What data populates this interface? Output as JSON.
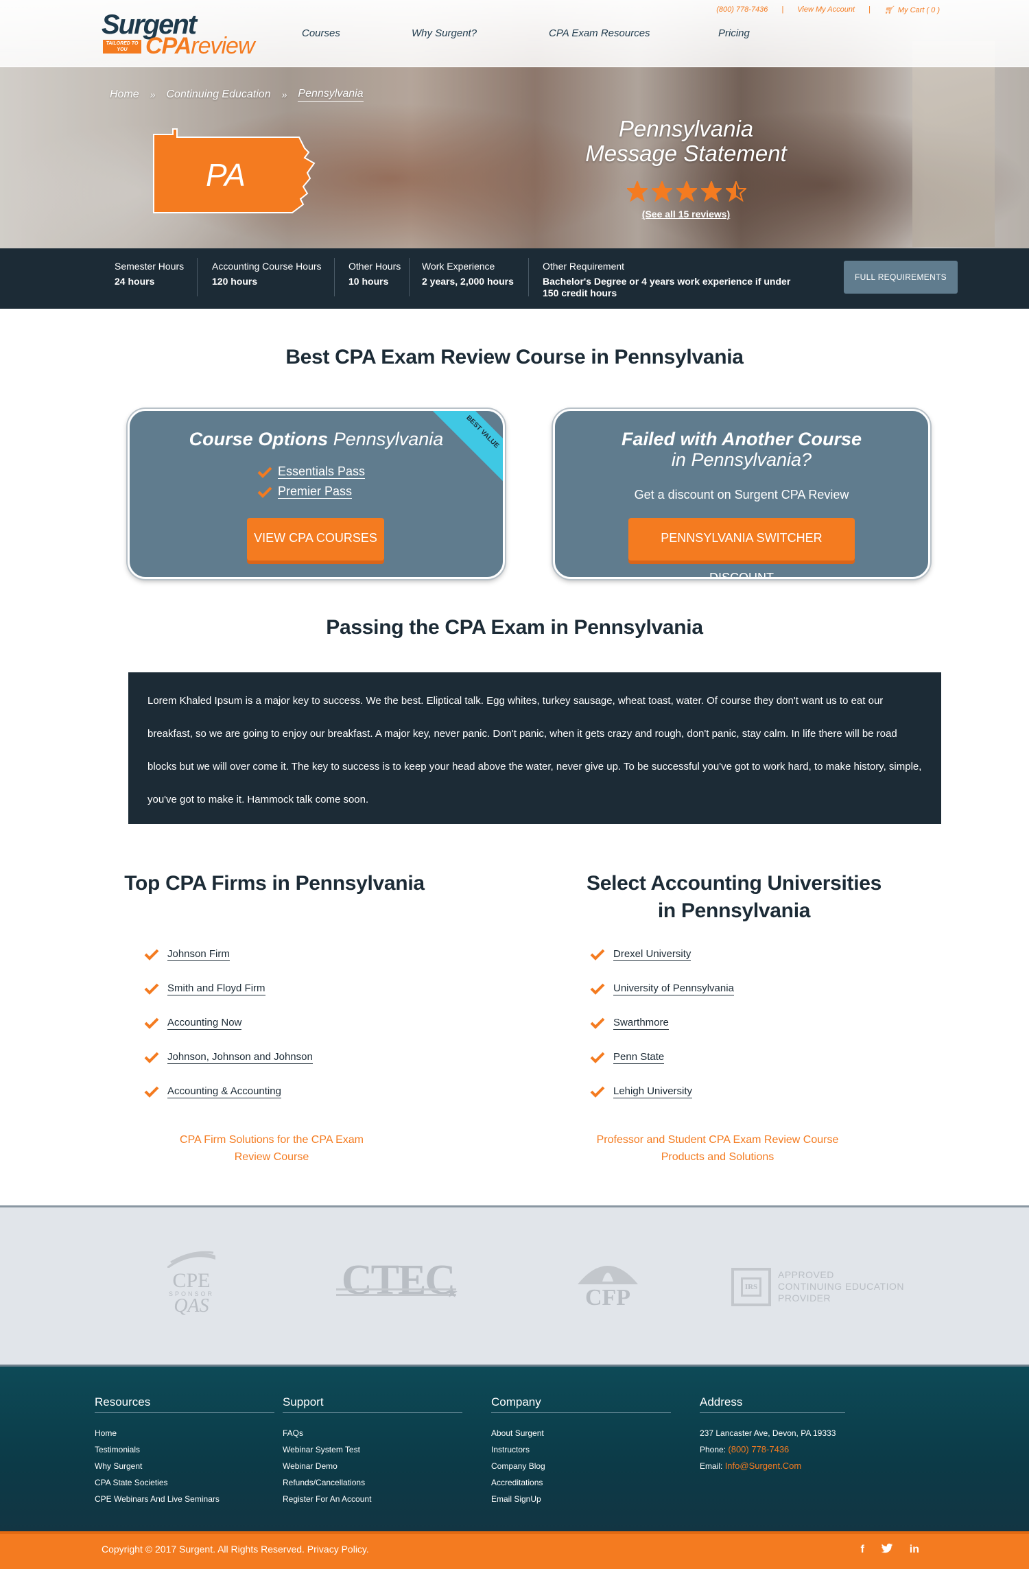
{
  "header": {
    "logo": {
      "brand": "Surgent",
      "product_strong": "CPA",
      "product_light": "review",
      "tagline": "TAILORED TO YOU"
    },
    "utility": {
      "phone": "(800) 778-7436",
      "account": "View My Account",
      "cart": "My Cart  ( 0 )"
    },
    "nav": [
      "Courses",
      "Why Surgent?",
      "CPA Exam Resources",
      "Pricing"
    ]
  },
  "breadcrumb": [
    "Home",
    "Continuing Education",
    "Pennsylvania"
  ],
  "hero": {
    "state_abbr": "PA",
    "title_line1": "Pennsylvania",
    "title_line2": "Message Statement",
    "rating": 4.5,
    "reviews_link": "(See all 15 reviews)",
    "colors": {
      "accent": "#f47b20",
      "star": "#f47b20"
    }
  },
  "requirements": {
    "items": [
      {
        "label": "Semester Hours",
        "value": "24 hours"
      },
      {
        "label": "Accounting Course Hours",
        "value": "120 hours"
      },
      {
        "label": "Other Hours",
        "value": "10 hours"
      },
      {
        "label": "Work Experience",
        "value": "2 years, 2,000 hours"
      },
      {
        "label": "Other Requirement",
        "value": "Bachelor's Degree or 4 years work experience if under 150 credit hours"
      }
    ],
    "button": "FULL REQUIREMENTS"
  },
  "best_course": {
    "heading": "Best CPA Exam Review Course in Pennsylvania",
    "card1": {
      "title_bold": "Course Options",
      "title_light": "Pennsylvania",
      "ribbon": "BEST VALUE",
      "options": [
        "Essentials Pass",
        "Premier Pass"
      ],
      "button": "VIEW CPA COURSES"
    },
    "card2": {
      "title_bold": "Failed with Another Course",
      "title_light": "in Pennsylvania?",
      "text": "Get a discount on Surgent CPA Review",
      "button": "PENNSYLVANIA SWITCHER DISCOUNT"
    }
  },
  "passing": {
    "heading": "Passing the CPA Exam in Pennsylvania",
    "body": "Lorem Khaled Ipsum is a major key to success. We the best. Eliptical talk. Egg whites, turkey sausage, wheat toast, water. Of course they don't want us to eat our breakfast, so we are going to enjoy our breakfast. A major key, never panic. Don't panic, when it gets crazy and rough, don't panic, stay calm. In life there will be road blocks but we will over come it. The key to success is to keep your head above the water, never give up. To be successful you've got to work hard, to make history, simple, you've got to make it. Hammock talk come soon."
  },
  "firms": {
    "heading": "Top CPA Firms in Pennsylvania",
    "items": [
      "Johnson Firm",
      "Smith and Floyd Firm",
      "Accounting Now",
      "Johnson, Johnson and Johnson",
      "Accounting & Accounting"
    ],
    "link_line1": "CPA Firm Solutions for the CPA Exam",
    "link_line2": "Review Course"
  },
  "universities": {
    "heading_line1": "Select Accounting Universities",
    "heading_line2": "in Pennsylvania",
    "items": [
      "Drexel University",
      "University of Pennsylvania",
      "Swarthmore",
      "Penn State",
      "Lehigh University"
    ],
    "link_line1": "Professor and Student CPA Exam Review Course",
    "link_line2": "Products and Solutions"
  },
  "accreditation": {
    "cpe_line1": "CPE",
    "cpe_line2": "SPONSOR",
    "cpe_line3": "QAS",
    "ctec": "CTEC",
    "cfp": "CFP",
    "irs_mark": "IRS",
    "irs_line1": "APPROVED",
    "irs_line2": "CONTINUING EDUCATION",
    "irs_line3": "PROVIDER"
  },
  "footer": {
    "resources": {
      "title": "Resources",
      "links": [
        "Home",
        "Testimonials",
        "Why Surgent",
        "CPA State Societies",
        "CPE Webinars And Live Seminars"
      ]
    },
    "support": {
      "title": "Support",
      "links": [
        "FAQs",
        "Webinar System Test",
        "Webinar Demo",
        "Refunds/Cancellations",
        "Register For An Account"
      ]
    },
    "company": {
      "title": "Company",
      "links": [
        "About Surgent",
        "Instructors",
        "Company Blog",
        "Accreditations",
        "Email SignUp"
      ]
    },
    "address": {
      "title": "Address",
      "street": "237 Lancaster Ave, Devon, PA 19333",
      "phone_label": "Phone:",
      "phone": "(800) 778-7436",
      "email_label": "Email:",
      "email": "Info@Surgent.Com"
    },
    "copyright": "Copyright © 2017 Surgent. All Rights Reserved. Privacy Policy.",
    "social": [
      "facebook-icon",
      "twitter-icon",
      "linkedin-icon"
    ]
  }
}
